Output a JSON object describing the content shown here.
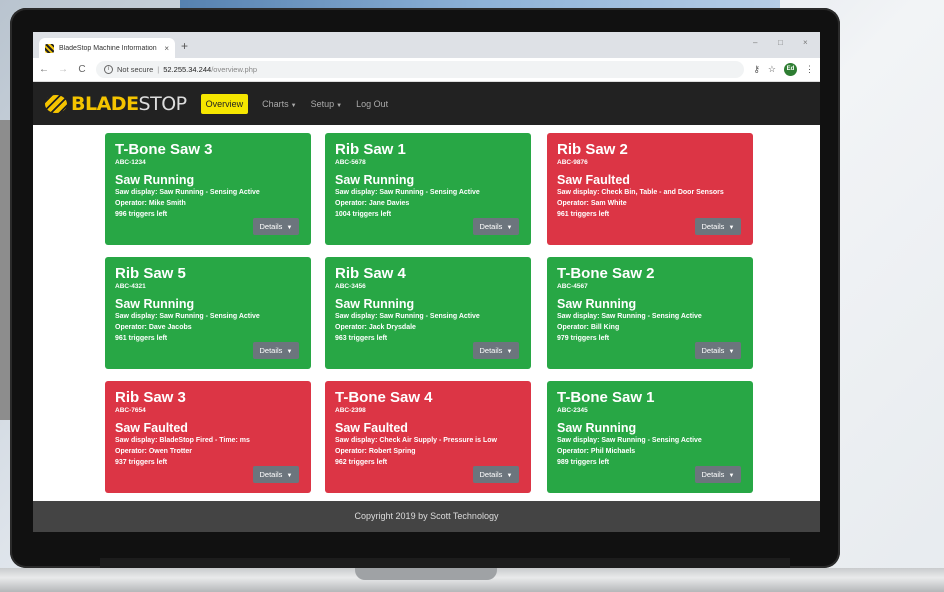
{
  "browser": {
    "tab_title": "BladeStop Machine Information",
    "tab_close": "×",
    "new_tab": "+",
    "window_minimize": "–",
    "window_maximize": "□",
    "window_close": "×",
    "security_label": "Not secure",
    "url_host": "52.255.34.244",
    "url_path": "/overview.php",
    "avatar_initials": "Ed"
  },
  "navbar": {
    "brand_part1": "BLADE",
    "brand_part2": "STOP",
    "items": [
      {
        "label": "Overview",
        "active": true
      },
      {
        "label": "Charts",
        "dropdown": true
      },
      {
        "label": "Setup",
        "dropdown": true
      },
      {
        "label": "Log Out"
      }
    ]
  },
  "cards": [
    {
      "title": "T-Bone Saw 3",
      "code": "ABC-1234",
      "status": "Saw Running",
      "display": "Saw display: Saw Running - Sensing Active",
      "operator": "Operator: Mike Smith",
      "triggers": "996 triggers left",
      "state": "running",
      "color": "#28a745"
    },
    {
      "title": "Rib Saw 1",
      "code": "ABC-5678",
      "status": "Saw Running",
      "display": "Saw display: Saw Running - Sensing Active",
      "operator": "Operator: Jane Davies",
      "triggers": "1004 triggers left",
      "state": "running",
      "color": "#28a745"
    },
    {
      "title": "Rib Saw 2",
      "code": "ABC-9876",
      "status": "Saw Faulted",
      "display": "Saw display: Check Bin, Table - and Door Sensors",
      "operator": "Operator: Sam White",
      "triggers": "961 triggers left",
      "state": "faulted",
      "color": "#dc3545"
    },
    {
      "title": "Rib Saw 5",
      "code": "ABC-4321",
      "status": "Saw Running",
      "display": "Saw display: Saw Running - Sensing Active",
      "operator": "Operator: Dave Jacobs",
      "triggers": "961 triggers left",
      "state": "running",
      "color": "#28a745"
    },
    {
      "title": "Rib Saw 4",
      "code": "ABC-3456",
      "status": "Saw Running",
      "display": "Saw display: Saw Running - Sensing Active",
      "operator": "Operator: Jack Drysdale",
      "triggers": "963 triggers left",
      "state": "running",
      "color": "#28a745"
    },
    {
      "title": "T-Bone Saw 2",
      "code": "ABC-4567",
      "status": "Saw Running",
      "display": "Saw display: Saw Running - Sensing Active",
      "operator": "Operator: Bill King",
      "triggers": "979 triggers left",
      "state": "running",
      "color": "#28a745"
    },
    {
      "title": "Rib Saw 3",
      "code": "ABC-7654",
      "status": "Saw Faulted",
      "display": "Saw display: BladeStop Fired - Time: ms",
      "operator": "Operator: Owen Trotter",
      "triggers": "937 triggers left",
      "state": "faulted",
      "color": "#dc3545"
    },
    {
      "title": "T-Bone Saw 4",
      "code": "ABC-2398",
      "status": "Saw Faulted",
      "display": "Saw display: Check Air Supply - Pressure is Low",
      "operator": "Operator: Robert Spring",
      "triggers": "962 triggers left",
      "state": "faulted",
      "color": "#dc3545"
    },
    {
      "title": "T-Bone Saw 1",
      "code": "ABC-2345",
      "status": "Saw Running",
      "display": "Saw display: Saw Running - Sensing Active",
      "operator": "Operator: Phil Michaels",
      "triggers": "989 triggers left",
      "state": "running",
      "color": "#28a745"
    }
  ],
  "details_label": "Details",
  "footer": {
    "text": "Copyright 2019 by Scott Technology"
  }
}
